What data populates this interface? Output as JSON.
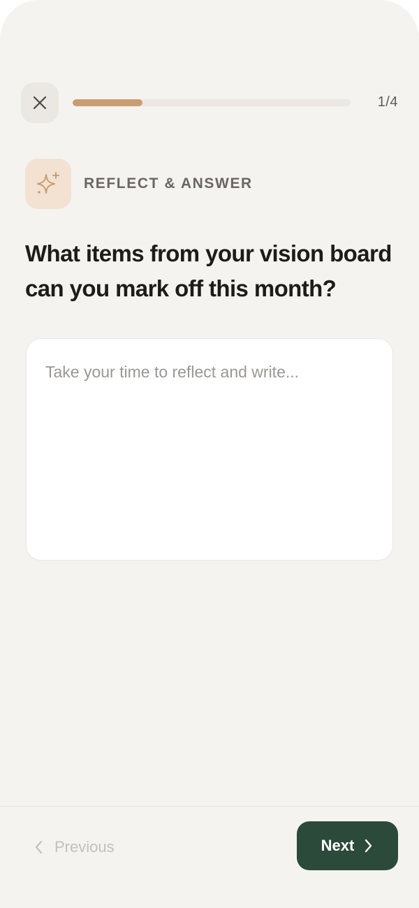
{
  "header": {
    "close_icon": "close-icon",
    "progress": {
      "current": 1,
      "total": 4,
      "fraction": 0.25
    },
    "step_label": "1/4"
  },
  "category": {
    "icon": "sparkles-icon",
    "label": "REFLECT & ANSWER"
  },
  "question": {
    "text": "What items from your vision board can you mark off this month?"
  },
  "answer": {
    "value": "",
    "placeholder": "Take your time to reflect and write..."
  },
  "footer": {
    "previous_label": "Previous",
    "previous_icon": "chevron-left-icon",
    "next_label": "Next",
    "next_icon": "chevron-right-icon"
  },
  "colors": {
    "background": "#f5f3ef",
    "accent": "#c99d74",
    "primary_button": "#2b4a3a",
    "icon_tile": "#f3e2d2"
  }
}
